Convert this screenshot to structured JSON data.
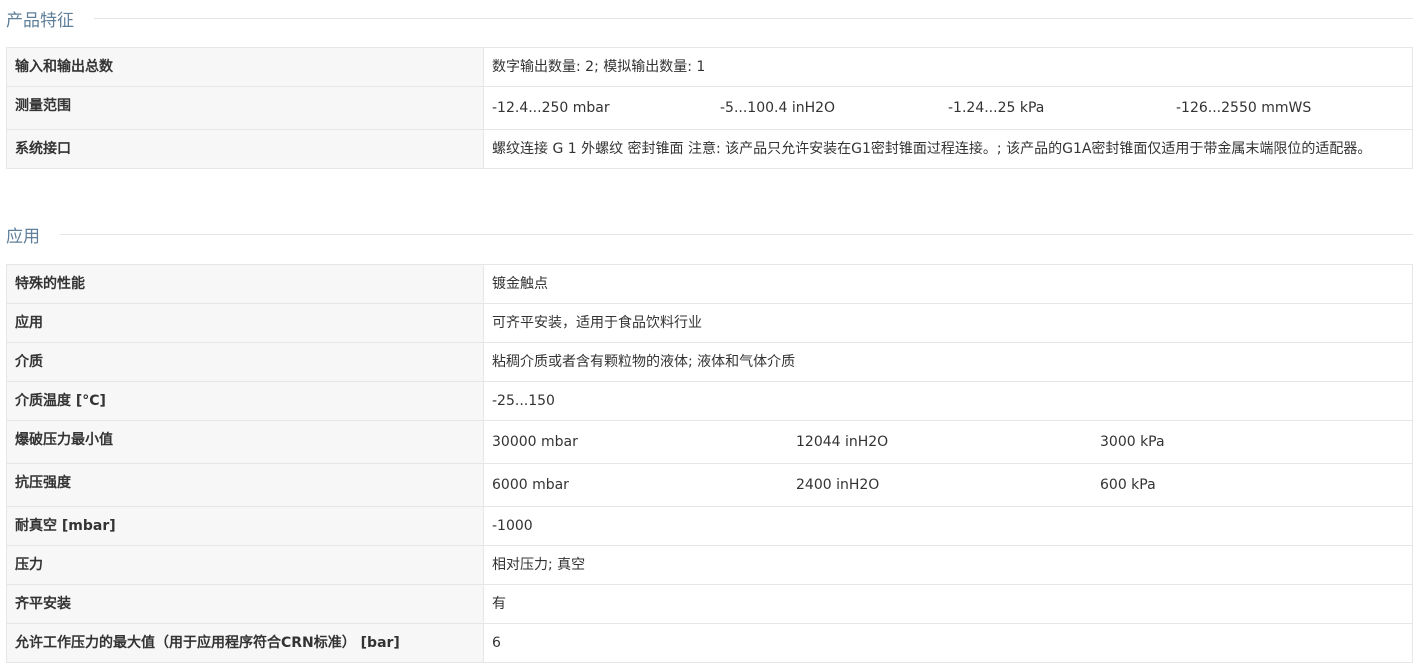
{
  "sections": [
    {
      "title": "产品特征",
      "rows": [
        {
          "label": "输入和输出总数",
          "value": "数字输出数量: 2; 模拟输出数量: 1"
        },
        {
          "label": "测量范围",
          "values": [
            "-12.4...250 mbar",
            "-5...100.4 inH2O",
            "-1.24...25 kPa",
            "-126...2550 mmWS"
          ]
        },
        {
          "label": "系统接口",
          "value": "螺纹连接 G 1 外螺纹 密封锥面 注意: 该产品只允许安装在G1密封锥面过程连接。; 该产品的G1A密封锥面仅适用于带金属末端限位的适配器。"
        }
      ]
    },
    {
      "title": "应用",
      "rows": [
        {
          "label": "特殊的性能",
          "value": "镀金触点"
        },
        {
          "label": "应用",
          "value": "可齐平安装，适用于食品饮料行业"
        },
        {
          "label": "介质",
          "value": "粘稠介质或者含有颗粒物的液体; 液体和气体介质"
        },
        {
          "label": "介质温度 [°C]",
          "value": "-25...150"
        },
        {
          "label": "爆破压力最小值",
          "values": [
            "30000 mbar",
            "12044 inH2O",
            "3000 kPa"
          ]
        },
        {
          "label": "抗压强度",
          "values": [
            "6000 mbar",
            "2400 inH2O",
            "600 kPa"
          ]
        },
        {
          "label": "耐真空 [mbar]",
          "value": "-1000"
        },
        {
          "label": "压力",
          "value": "相对压力; 真空"
        },
        {
          "label": "齐平安装",
          "value": "有"
        },
        {
          "label": "允许工作压力的最大值（用于应用程序符合CRN标准） [bar]",
          "value": "6"
        }
      ]
    }
  ]
}
